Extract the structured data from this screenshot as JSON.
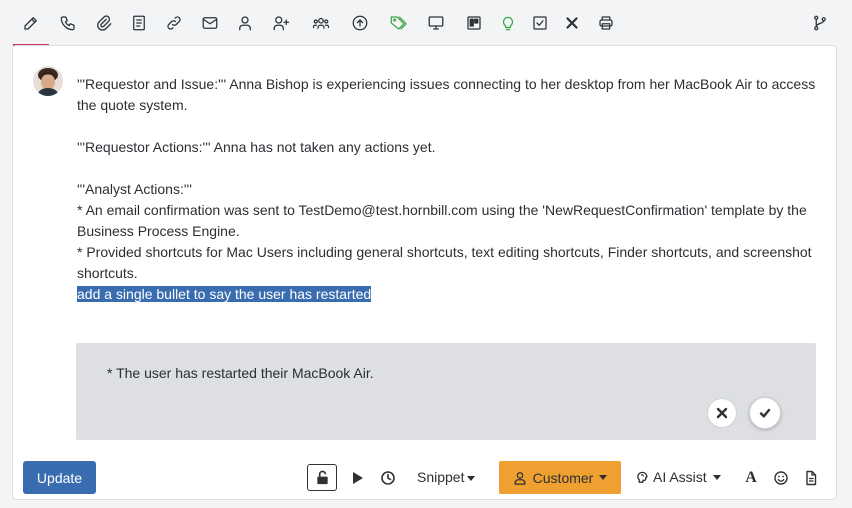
{
  "toolbar": {
    "icons": [
      "edit-icon",
      "phone-icon",
      "paperclip-icon",
      "book-icon",
      "link-icon",
      "mail-icon",
      "user-icon",
      "user-plus-icon",
      "users-icon",
      "upload-icon",
      "tag-icon",
      "desktop-icon",
      "board-icon",
      "lightbulb-icon",
      "checkbox-icon",
      "close-icon",
      "print-icon",
      "branch-icon"
    ],
    "active_color": "#d0355a"
  },
  "note": {
    "line1": "'''Requestor and Issue:''' Anna Bishop is experiencing issues connecting to her desktop from her MacBook Air to access the quote system.",
    "line2": "'''Requestor Actions:''' Anna has not taken any actions yet.",
    "line3": "'''Analyst Actions:'''",
    "line4": "* An email confirmation was sent to TestDemo@test.hornbill.com using the 'NewRequestConfirmation' template by the Business Process Engine.",
    "line5": "* Provided shortcuts for Mac Users including general shortcuts, text editing shortcuts, Finder shortcuts, and screenshot shortcuts.",
    "selected": "add a single bullet to say the user has restarted"
  },
  "ai_suggestion": {
    "text": "* The user has restarted their MacBook Air."
  },
  "bottom": {
    "update_label": "Update",
    "snippet_label": "Snippet",
    "customer_label": "Customer",
    "ai_assist_label": "AI Assist",
    "font_glyph": "A",
    "colors": {
      "update": "#3a6db0",
      "customer": "#f0a030"
    }
  }
}
